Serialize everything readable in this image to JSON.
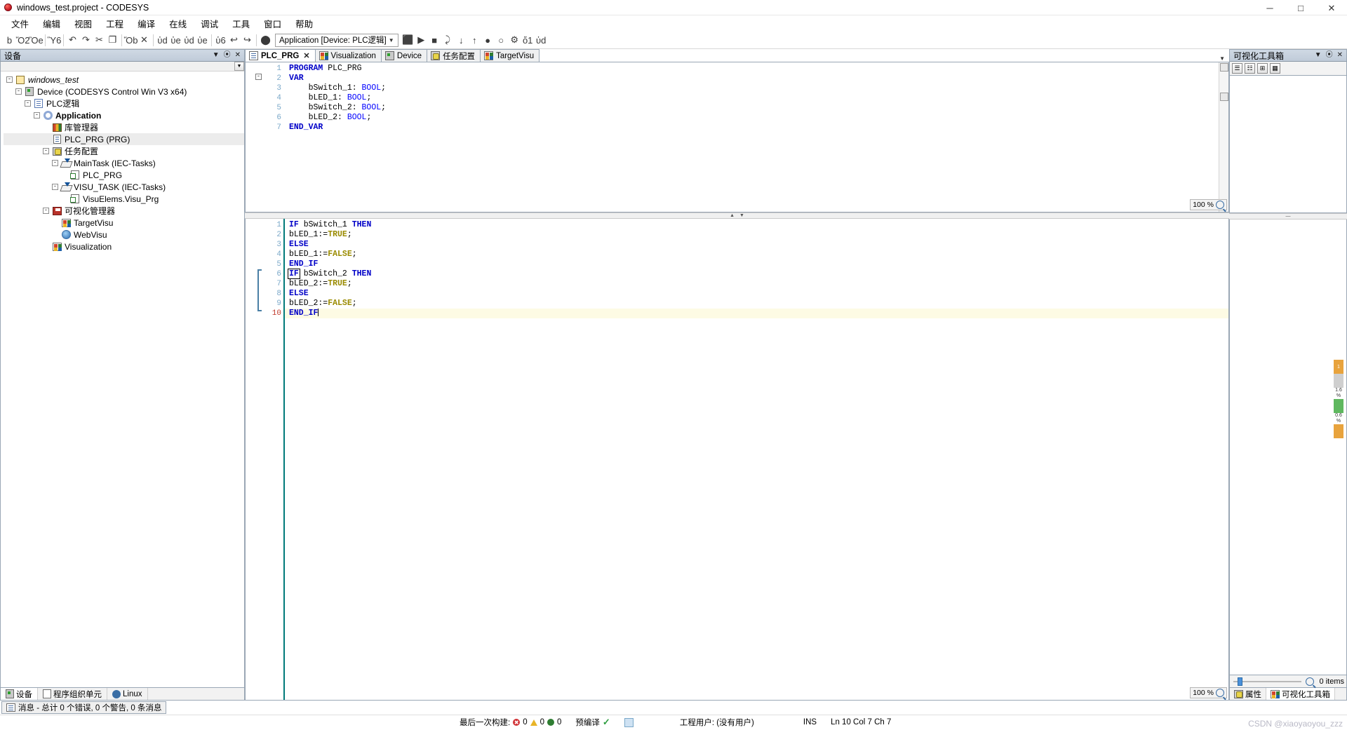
{
  "window": {
    "title": "windows_test.project - CODESYS",
    "minimize": "─",
    "maximize": "□",
    "close": "✕"
  },
  "menu": {
    "items": [
      "文件",
      "编辑",
      "视图",
      "工程",
      "编译",
      "在线",
      "调试",
      "工具",
      "窗口",
      "帮助"
    ]
  },
  "toolbar": {
    "application_combo": "Application [Device: PLC逻辑]",
    "combo_arrow": "▼",
    "buttons": [
      {
        "name": "new-project-icon",
        "glyph": "὜b"
      },
      {
        "name": "open-project-icon",
        "glyph": "Ὄ2"
      },
      {
        "name": "save-icon",
        "glyph": "Ὃe"
      },
      {
        "name": "print-icon",
        "glyph": "Ὓ6"
      },
      {
        "name": "undo-icon",
        "glyph": "↶"
      },
      {
        "name": "redo-icon",
        "glyph": "↷"
      },
      {
        "name": "cut-icon",
        "glyph": "✂"
      },
      {
        "name": "copy-icon",
        "glyph": "❐"
      },
      {
        "name": "paste-icon",
        "glyph": "Ὄb"
      },
      {
        "name": "delete-icon",
        "glyph": "✕"
      },
      {
        "name": "find-icon",
        "glyph": "ὐd"
      },
      {
        "name": "find-next-icon",
        "glyph": "ὐe"
      },
      {
        "name": "find-prev-icon",
        "glyph": "ὐd"
      },
      {
        "name": "replace-icon",
        "glyph": "ὐe"
      },
      {
        "name": "bookmark-icon",
        "glyph": "ὑ6"
      },
      {
        "name": "prev-bookmark-icon",
        "glyph": "↩"
      },
      {
        "name": "next-bookmark-icon",
        "glyph": "↪"
      },
      {
        "name": "login-icon",
        "glyph": "⬤"
      },
      {
        "name": "logout-icon",
        "glyph": "⬛"
      },
      {
        "name": "start-icon",
        "glyph": "▶"
      },
      {
        "name": "stop-icon",
        "glyph": "■"
      },
      {
        "name": "step-over-icon",
        "glyph": "⤸"
      },
      {
        "name": "step-into-icon",
        "glyph": "↓"
      },
      {
        "name": "step-out-icon",
        "glyph": "↑"
      },
      {
        "name": "breakpoint-icon",
        "glyph": "●"
      },
      {
        "name": "toggle-bp-icon",
        "glyph": "○"
      },
      {
        "name": "build-icon",
        "glyph": "⚙"
      },
      {
        "name": "watch-icon",
        "glyph": "ὄ1"
      },
      {
        "name": "zoom-tool-icon",
        "glyph": "ὐd"
      }
    ]
  },
  "left_panel": {
    "title": "设备",
    "header_buttons": [
      "▼",
      "⦿",
      "✕"
    ],
    "scroll_arrow": "▼",
    "tree": [
      {
        "label": "windows_test",
        "depth": 0,
        "toggle": "-",
        "icon": "project-icon",
        "style": "italic"
      },
      {
        "label": "Device (CODESYS Control Win V3 x64)",
        "depth": 1,
        "toggle": "-",
        "icon": "device-icon",
        "style": ""
      },
      {
        "label": "PLC逻辑",
        "depth": 2,
        "toggle": "-",
        "icon": "plc-logic-icon",
        "style": ""
      },
      {
        "label": "Application",
        "depth": 3,
        "toggle": "-",
        "icon": "application-icon",
        "style": "bold"
      },
      {
        "label": "库管理器",
        "depth": 4,
        "toggle": "",
        "icon": "library-manager-icon",
        "style": ""
      },
      {
        "label": "PLC_PRG (PRG)",
        "depth": 4,
        "toggle": "",
        "icon": "pou-icon",
        "style": "",
        "selected": true
      },
      {
        "label": "任务配置",
        "depth": 4,
        "toggle": "-",
        "icon": "task-config-icon",
        "style": ""
      },
      {
        "label": "MainTask (IEC-Tasks)",
        "depth": 5,
        "toggle": "-",
        "icon": "iec-task-icon",
        "style": ""
      },
      {
        "label": "PLC_PRG",
        "depth": 6,
        "toggle": "",
        "icon": "task-pou-icon",
        "style": ""
      },
      {
        "label": "VISU_TASK (IEC-Tasks)",
        "depth": 5,
        "toggle": "-",
        "icon": "iec-task-icon",
        "style": ""
      },
      {
        "label": "VisuElems.Visu_Prg",
        "depth": 6,
        "toggle": "",
        "icon": "task-pou-icon",
        "style": ""
      },
      {
        "label": "可视化管理器",
        "depth": 4,
        "toggle": "-",
        "icon": "visu-manager-icon",
        "style": ""
      },
      {
        "label": "TargetVisu",
        "depth": 5,
        "toggle": "",
        "icon": "target-visu-icon",
        "style": ""
      },
      {
        "label": "WebVisu",
        "depth": 5,
        "toggle": "",
        "icon": "web-visu-icon",
        "style": ""
      },
      {
        "label": "Visualization",
        "depth": 4,
        "toggle": "",
        "icon": "visualization-icon",
        "style": ""
      }
    ],
    "bottom_tabs": [
      {
        "label": "设备",
        "icon": "devices-icon",
        "active": true
      },
      {
        "label": "程序组织单元",
        "icon": "pou-tab-icon",
        "active": false
      },
      {
        "label": "Linux",
        "icon": "linux-icon",
        "active": false
      }
    ]
  },
  "editor": {
    "tabs": [
      {
        "label": "PLC_PRG",
        "icon": "pou-icon",
        "active": true,
        "closable": true,
        "close_glyph": "✕"
      },
      {
        "label": "Visualization",
        "icon": "visualization-icon",
        "active": false,
        "closable": false
      },
      {
        "label": "Device",
        "icon": "device-icon",
        "active": false,
        "closable": false
      },
      {
        "label": "任务配置",
        "icon": "task-config-icon",
        "active": false,
        "closable": false
      },
      {
        "label": "TargetVisu",
        "icon": "target-visu-icon",
        "active": false,
        "closable": false
      }
    ],
    "tabstrip_arrow": "▼",
    "declaration": {
      "fold_marker": "-",
      "zoom_level": "100 %",
      "lines": [
        {
          "num": "1",
          "tokens": [
            {
              "t": "PROGRAM",
              "c": "kw"
            },
            {
              "t": " PLC_PRG",
              "c": ""
            }
          ]
        },
        {
          "num": "2",
          "tokens": [
            {
              "t": "VAR",
              "c": "kw"
            }
          ]
        },
        {
          "num": "3",
          "tokens": [
            {
              "t": "    bSwitch_1: ",
              "c": ""
            },
            {
              "t": "BOOL",
              "c": "ty"
            },
            {
              "t": ";",
              "c": ""
            }
          ]
        },
        {
          "num": "4",
          "tokens": [
            {
              "t": "    bLED_1: ",
              "c": ""
            },
            {
              "t": "BOOL",
              "c": "ty"
            },
            {
              "t": ";",
              "c": ""
            }
          ]
        },
        {
          "num": "5",
          "tokens": [
            {
              "t": "    bSwitch_2: ",
              "c": ""
            },
            {
              "t": "BOOL",
              "c": "ty"
            },
            {
              "t": ";",
              "c": ""
            }
          ]
        },
        {
          "num": "6",
          "tokens": [
            {
              "t": "    bLED_2: ",
              "c": ""
            },
            {
              "t": "BOOL",
              "c": "ty"
            },
            {
              "t": ";",
              "c": ""
            }
          ]
        },
        {
          "num": "7",
          "tokens": [
            {
              "t": "END_VAR",
              "c": "kw"
            }
          ]
        }
      ]
    },
    "implementation": {
      "zoom_level": "100 %",
      "lines": [
        {
          "num": "1",
          "tokens": [
            {
              "t": "IF",
              "c": "kw"
            },
            {
              "t": " bSwitch_1 ",
              "c": ""
            },
            {
              "t": "THEN",
              "c": "kw"
            }
          ]
        },
        {
          "num": "2",
          "tokens": [
            {
              "t": "bLED_1:=",
              "c": ""
            },
            {
              "t": "TRUE",
              "c": "lit"
            },
            {
              "t": ";",
              "c": ""
            }
          ]
        },
        {
          "num": "3",
          "tokens": [
            {
              "t": "ELSE",
              "c": "kw"
            }
          ]
        },
        {
          "num": "4",
          "tokens": [
            {
              "t": "bLED_1:=",
              "c": ""
            },
            {
              "t": "FALSE",
              "c": "lit"
            },
            {
              "t": ";",
              "c": ""
            }
          ]
        },
        {
          "num": "5",
          "tokens": [
            {
              "t": "END_IF",
              "c": "kw"
            }
          ]
        },
        {
          "num": "6",
          "tokens": [
            {
              "t": "IF",
              "c": "kw boxed"
            },
            {
              "t": " bSwitch_2 ",
              "c": ""
            },
            {
              "t": "THEN",
              "c": "kw"
            }
          ]
        },
        {
          "num": "7",
          "tokens": [
            {
              "t": "bLED_2:=",
              "c": ""
            },
            {
              "t": "TRUE",
              "c": "lit"
            },
            {
              "t": ";",
              "c": ""
            }
          ]
        },
        {
          "num": "8",
          "tokens": [
            {
              "t": "ELSE",
              "c": "kw"
            }
          ]
        },
        {
          "num": "9",
          "tokens": [
            {
              "t": "bLED_2:=",
              "c": ""
            },
            {
              "t": "FALSE",
              "c": "lit"
            },
            {
              "t": ";",
              "c": ""
            }
          ]
        },
        {
          "num": "10",
          "tokens": [
            {
              "t": "END_IF",
              "c": "kw"
            }
          ],
          "current": true,
          "caret": true
        }
      ]
    },
    "splitter_arrows": [
      "▲",
      "▼"
    ]
  },
  "right_panel": {
    "title": "可视化工具箱",
    "header_buttons": [
      "▼",
      "⦿",
      "✕"
    ],
    "tool_buttons": [
      {
        "name": "list-view-icon",
        "glyph": "☰"
      },
      {
        "name": "details-view-icon",
        "glyph": "☷"
      },
      {
        "name": "tile-view-icon",
        "glyph": "⊞"
      },
      {
        "name": "category-view-icon",
        "glyph": "▦"
      }
    ],
    "splitter_arrow": "—",
    "items_count": "0 items",
    "zoom_icon": "search-icon",
    "bottom_tabs": [
      {
        "label": "属性",
        "icon": "properties-icon",
        "active": false
      },
      {
        "label": "可视化工具箱",
        "icon": "toolbox-icon",
        "active": true
      }
    ],
    "value_strip": {
      "top_badge": "1",
      "values": [
        "1.6",
        "0.6"
      ],
      "units": [
        "%",
        "%"
      ]
    }
  },
  "message_bar": {
    "tab_label": "消息 - 总计 0 个错误, 0 个警告, 0 条消息",
    "icon": "message-icon"
  },
  "status_bar": {
    "last_build_label": "最后一次构建:",
    "errors": "0",
    "warnings": "0",
    "messages": "0",
    "precompile_label": "预编译",
    "precompile_check": "✓",
    "project_user_label": "工程用户: (没有用户)",
    "insert_mode": "INS",
    "cursor_position": "Ln 10  Col 7  Ch 7",
    "watermark": "CSDN @xiaoyaoyou_zzz"
  }
}
